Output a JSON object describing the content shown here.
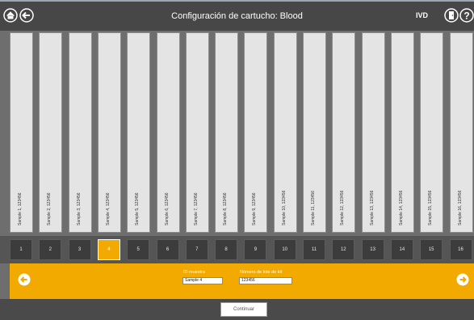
{
  "header": {
    "title": "Configuración de cartucho: Blood",
    "badge": "IVD",
    "home_icon": "home-icon",
    "back_icon": "back-arrow-icon",
    "door_icon": "door-icon",
    "help_icon": "help-icon"
  },
  "samples": [
    "Sample 1, 123456",
    "Sample 2, 123456",
    "Sample 3, 123456",
    "Sample 4, 123456",
    "Sample 5, 123456",
    "Sample 6, 123456",
    "Sample 7, 123456",
    "Sample 8, 123456",
    "Sample 9, 123456",
    "Sample 10, 123456",
    "Sample 11, 123456",
    "Sample 12, 123456",
    "Sample 13, 123456",
    "Sample 14, 123456",
    "Sample 15, 123456",
    "Sample 16, 123456"
  ],
  "numbers": [
    "1",
    "2",
    "3",
    "4",
    "5",
    "6",
    "7",
    "8",
    "9",
    "10",
    "11",
    "12",
    "13",
    "14",
    "15",
    "16"
  ],
  "selected_index": 3,
  "form": {
    "id_label": "ID muestra",
    "id_value": "Sample 4",
    "lot_label": "Número de lote de kit",
    "lot_value": "123456"
  },
  "continue_label": "Continuar",
  "colors": {
    "accent": "#f2a900",
    "bar": "#474747"
  }
}
